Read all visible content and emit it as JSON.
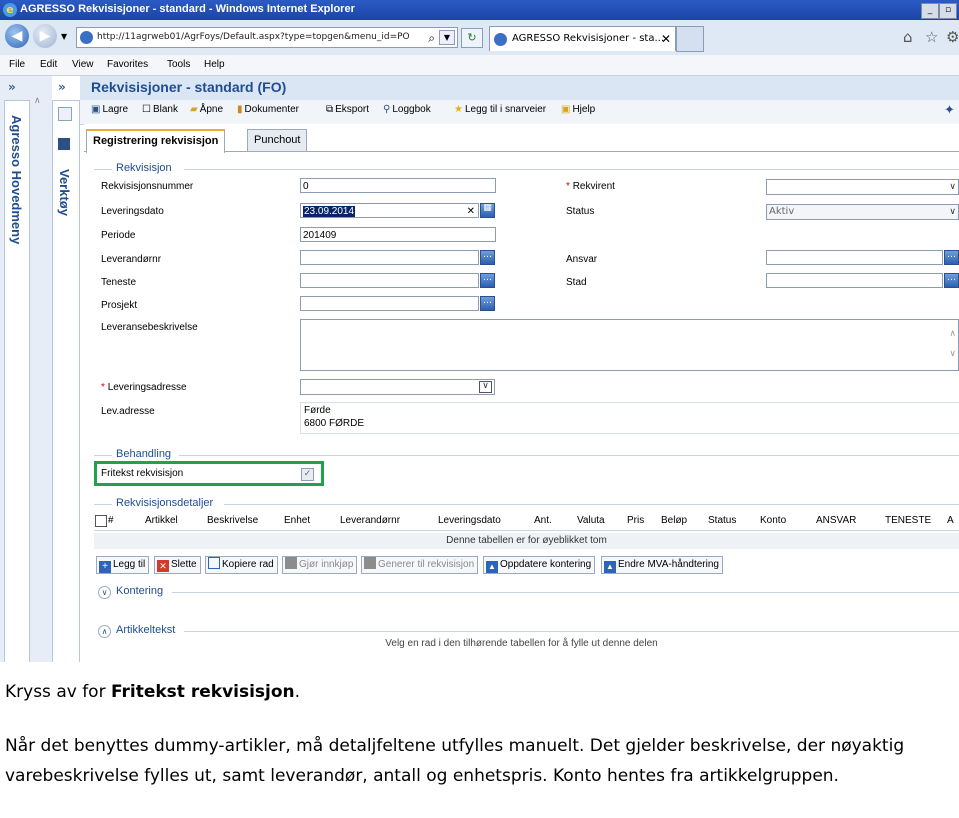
{
  "browser": {
    "window_title": "AGRESSO Rekvisisjoner - standard - Windows Internet Explorer",
    "url": "http://11agrweb01/AgrFoys/Default.aspx?type=topgen&menu_id=PO",
    "tab_label": "AGRESSO Rekvisisjoner - sta...",
    "menu": [
      "File",
      "Edit",
      "View",
      "Favorites",
      "Tools",
      "Help"
    ]
  },
  "nav": {
    "main_menu": "Agresso Hovedmeny",
    "tools": "Verktøy"
  },
  "app": {
    "title": "Rekvisisjoner - standard (FO)",
    "toolbar": {
      "save": "Lagre",
      "blank": "Blank",
      "open": "Åpne",
      "documents": "Dokumenter",
      "export": "Eksport",
      "log": "Loggbok",
      "add_shortcut": "Legg til i snarveier",
      "help": "Hjelp"
    },
    "tabs": [
      "Registrering rekvisisjon",
      "Punchout"
    ]
  },
  "form": {
    "section_requisition": "Rekvisisjon",
    "req_number_label": "Rekvisisjonsnummer",
    "req_number": "0",
    "delivery_date_label": "Leveringsdato",
    "delivery_date": "23.09.2014",
    "period_label": "Periode",
    "period": "201409",
    "supplier_label": "Leverandørnr",
    "service_label": "Teneste",
    "project_label": "Prosjekt",
    "delivery_desc_label": "Leveransebeskrivelse",
    "delivery_address_label": "Leveringsadresse",
    "lev_address_label": "Lev.adresse",
    "lev_address_line1": "Førde",
    "lev_address_line2": "6800 FØRDE",
    "requester_label": "Rekvirent",
    "status_label": "Status",
    "status_value": "Aktiv",
    "responsibility_label": "Ansvar",
    "place_label": "Stad",
    "section_processing": "Behandling",
    "freetext_label": "Fritekst rekvisisjon",
    "freetext_checked": true,
    "section_details": "Rekvisisjonsdetaljer",
    "grid_columns": [
      "#",
      "Artikkel",
      "Beskrivelse",
      "Enhet",
      "Leverandørnr",
      "Leveringsdato",
      "Ant.",
      "Valuta",
      "Pris",
      "Beløp",
      "Status",
      "Konto",
      "ANSVAR",
      "TENESTE",
      "A"
    ],
    "grid_empty": "Denne tabellen er for øyeblikket tom",
    "grid_buttons": [
      "Legg til",
      "Slette",
      "Kopiere rad",
      "Gjør innkjøp",
      "Generer til rekvisisjon",
      "Oppdatere kontering",
      "Endre MVA-håndtering"
    ],
    "section_posting": "Kontering",
    "section_article_text": "Artikkeltekst",
    "hint": "Velg en rad i den tilhørende tabellen for å fylle ut denne delen"
  },
  "caption": {
    "line1_prefix": "Kryss av for ",
    "line1_bold": "Fritekst rekvisisjon",
    "line1_suffix": ".",
    "paragraph": "Når det benyttes dummy-artikler, må detaljfeltene utfylles manuelt. Det gjelder beskrivelse, der nøyaktig varebeskrivelse fylles ut, samt leverandør, antall og enhetspris. Konto hentes fra artikkelgruppen."
  }
}
